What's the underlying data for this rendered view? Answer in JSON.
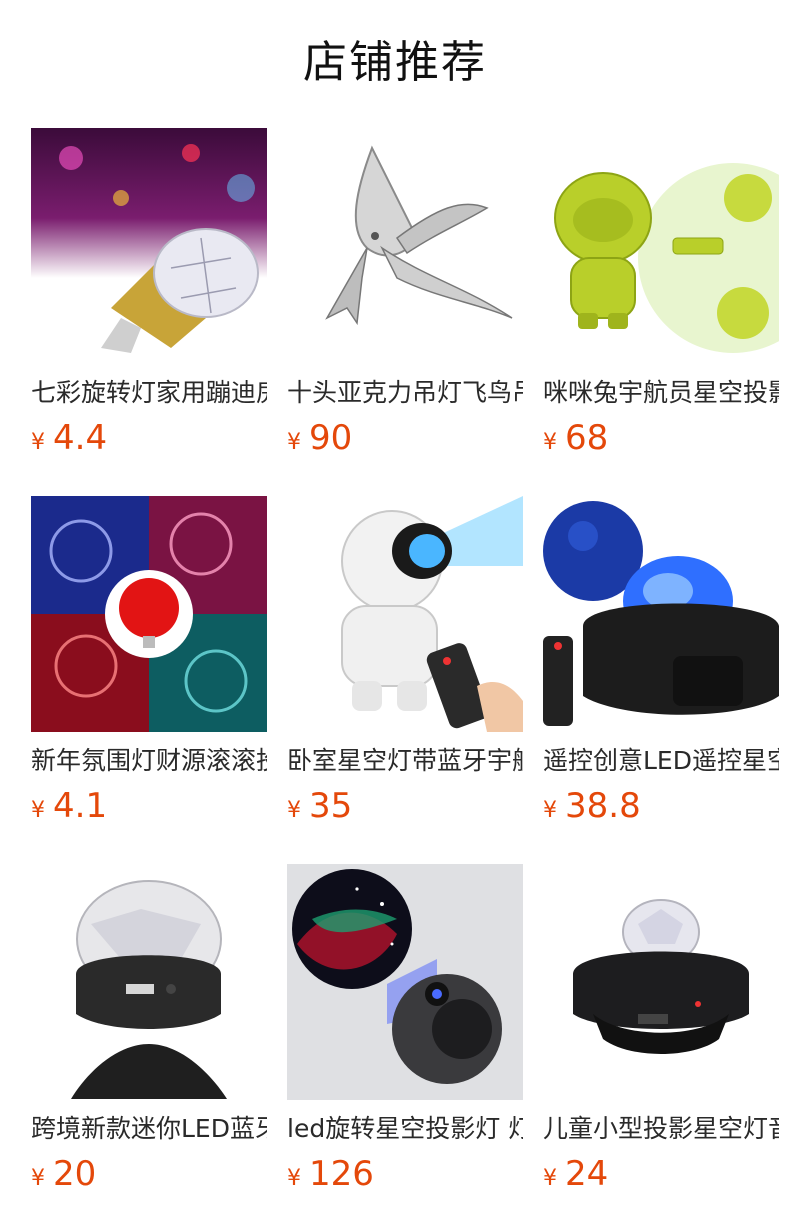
{
  "header": {
    "title": "店铺推荐"
  },
  "colors": {
    "price": "#e4480a"
  },
  "products": [
    {
      "title": "七彩旋转灯家用蹦迪房间酒吧",
      "currency": "¥",
      "price": "4.4",
      "icon": "rotating-disco-bulb-image"
    },
    {
      "title": "十头亚克力吊灯飞鸟吊灯",
      "currency": "¥",
      "price": "90",
      "icon": "acrylic-bird-pendant-image"
    },
    {
      "title": "咪咪兔宇航员星空投影灯",
      "currency": "¥",
      "price": "68",
      "icon": "green-astronaut-projector-image"
    },
    {
      "title": "新年氛围灯财源滚滚投影灯",
      "currency": "¥",
      "price": "4.1",
      "icon": "new-year-fu-projection-bulb-image"
    },
    {
      "title": "卧室星空灯带蓝牙宇航员投影灯",
      "currency": "¥",
      "price": "35",
      "icon": "white-astronaut-projector-image"
    },
    {
      "title": "遥控创意LED遥控星空投影灯",
      "currency": "¥",
      "price": "38.8",
      "icon": "ocean-wave-projector-image"
    },
    {
      "title": "跨境新款迷你LED蓝牙音箱",
      "currency": "¥",
      "price": "20",
      "icon": "mini-crystal-ball-speaker-image"
    },
    {
      "title": "led旋转星空投影灯 灯",
      "currency": "¥",
      "price": "126",
      "icon": "galaxy-projector-image"
    },
    {
      "title": "儿童小型投影星空灯音乐",
      "currency": "¥",
      "price": "24",
      "icon": "ufo-star-projector-image"
    }
  ]
}
